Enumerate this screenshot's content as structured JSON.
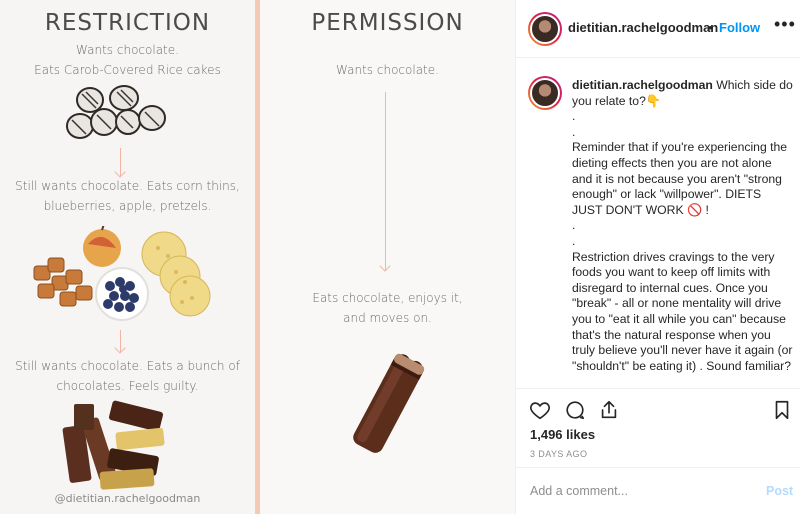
{
  "infographic": {
    "left": {
      "heading": "RESTRICTION",
      "caption1_line1": "Wants chocolate.",
      "caption1_line2": "Eats Carob-Covered Rice cakes",
      "caption2_line1": "Still wants chocolate. Eats corn thins,",
      "caption2_line2": "blueberries, apple, pretzels.",
      "caption3_line1": "Still wants chocolate. Eats a bunch of",
      "caption3_line2": "chocolates. Feels guilty."
    },
    "right": {
      "heading": "PERMISSION",
      "caption1": "Wants chocolate.",
      "caption2_line1": "Eats chocolate, enjoys it,",
      "caption2_line2": "and moves on."
    },
    "watermark": "@dietitian.rachelgoodman",
    "colors": {
      "divider": "#f6c9b4",
      "arrow": "#f1b5a3"
    }
  },
  "sidebar": {
    "header": {
      "username": "dietitian.rachelgoodman",
      "separator": "•",
      "follow_label": "Follow",
      "more_icon": "more-horizontal-icon"
    },
    "caption": {
      "username": "dietitian.rachelgoodman",
      "intro": "Which side do you relate to?👇",
      "dot1": ".",
      "dot2": ".",
      "para1": "Reminder that if you're experiencing the dieting effects then you are not alone and it is not because you aren't \"strong enough\" or lack \"willpower\". DIETS JUST DON'T WORK 🚫 !",
      "dot3": ".",
      "dot4": ".",
      "para2": "Restriction drives cravings to the very foods you want to keep off limits with disregard to internal cues. Once you \"break\" - all or none mentality will drive you to \"eat it all while you can\" because that's the natural response when you truly believe you'll never have it again (or \"shouldn't\" be eating it) . Sound familiar?"
    },
    "actions": {
      "like_icon": "heart-icon",
      "comment_icon": "comment-icon",
      "share_icon": "share-icon",
      "save_icon": "bookmark-icon",
      "likes": "1,496 likes",
      "date": "3 DAYS AGO"
    },
    "comment": {
      "placeholder": "Add a comment...",
      "post_label": "Post"
    },
    "colors": {
      "follow": "#0095f6",
      "post_disabled": "#b3dbff"
    }
  }
}
